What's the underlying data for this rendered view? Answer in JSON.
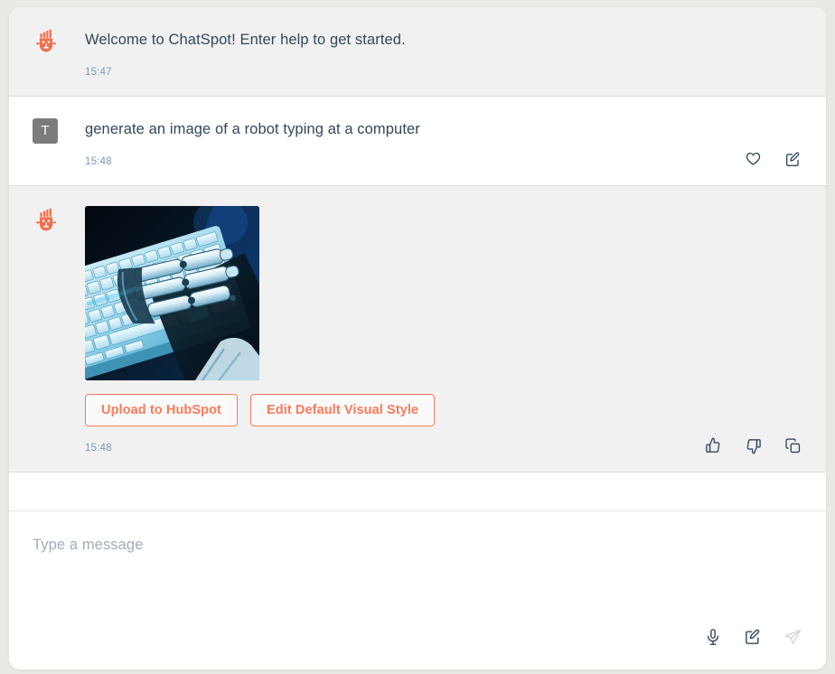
{
  "app": {
    "name": "ChatSpot",
    "accent_color": "#FF7A59",
    "text_color": "#33475B",
    "bot_row_background": "#F1F1F1",
    "user_row_background": "#FFFFFF",
    "page_background": "#EAE8E5"
  },
  "messages": [
    {
      "role": "bot",
      "avatar_name": "chatspot-robot-avatar",
      "text": "Welcome to ChatSpot! Enter help to get started.",
      "timestamp": "15:47",
      "actions": []
    },
    {
      "role": "user",
      "avatar_initial": "T",
      "text": "generate an image of a robot typing at a computer",
      "timestamp": "15:48",
      "actions": [
        {
          "name": "favorite-button",
          "icon": "heart-icon"
        },
        {
          "name": "edit-message-button",
          "icon": "edit-square-icon"
        }
      ]
    },
    {
      "role": "bot",
      "avatar_name": "chatspot-robot-avatar",
      "image_alt": "Generated image of a robotic hand typing at a blue backlit computer keyboard",
      "timestamp": "15:48",
      "buttons": [
        {
          "name": "upload-to-hubspot-button",
          "label": "Upload to HubSpot"
        },
        {
          "name": "edit-default-visual-style-button",
          "label": "Edit Default Visual Style"
        }
      ],
      "actions": [
        {
          "name": "thumbs-up-button",
          "icon": "thumbs-up-icon"
        },
        {
          "name": "thumbs-down-button",
          "icon": "thumbs-down-icon"
        },
        {
          "name": "copy-button",
          "icon": "copy-icon"
        }
      ]
    }
  ],
  "composer": {
    "placeholder": "Type a message",
    "value": "",
    "actions": [
      {
        "name": "microphone-button",
        "icon": "microphone-icon",
        "enabled": true
      },
      {
        "name": "compose-button",
        "icon": "edit-square-icon",
        "enabled": true
      },
      {
        "name": "send-button",
        "icon": "send-paper-plane-icon",
        "enabled": false
      }
    ]
  }
}
